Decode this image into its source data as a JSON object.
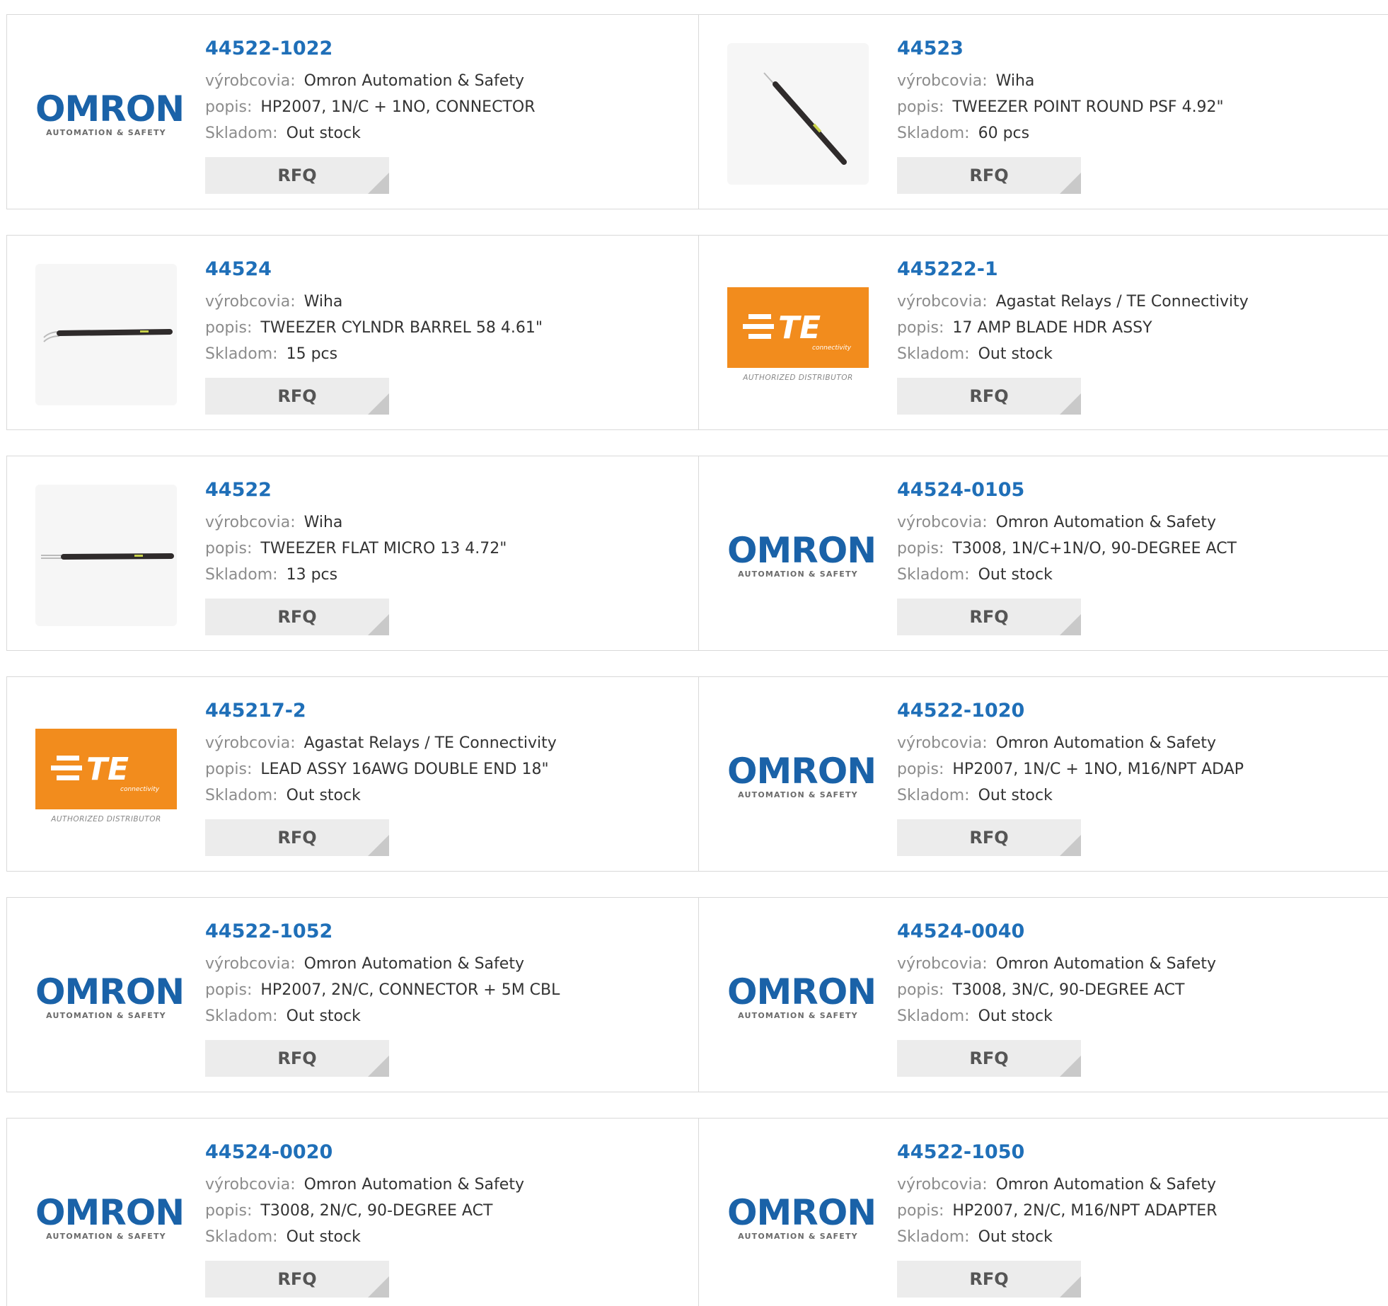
{
  "labels": {
    "manufacturer": "výrobcovia:",
    "description": "popis:",
    "stock": "Skladom:",
    "rfq": "RFQ"
  },
  "logos": {
    "omron_word": "OMRON",
    "omron_sub": "AUTOMATION & SAFETY",
    "te_word": "TE",
    "te_small": "connectivity",
    "te_sub": "AUTHORIZED DISTRIBUTOR"
  },
  "colors": {
    "link": "#1f6fb8",
    "omron_blue": "#1a62a8",
    "te_orange": "#f28c1d",
    "rfq_bg": "#ececec"
  },
  "products": [
    {
      "pn": "44522-1022",
      "mfr": "Omron Automation & Safety",
      "desc": "HP2007, 1N/C + 1NO, CONNECTOR",
      "stock": "Out stock",
      "logo": "omron"
    },
    {
      "pn": "44523",
      "mfr": "Wiha",
      "desc": "TWEEZER POINT ROUND PSF 4.92\"",
      "stock": "60 pcs",
      "logo": "tweezer-diagonal"
    },
    {
      "pn": "44524",
      "mfr": "Wiha",
      "desc": "TWEEZER CYLNDR BARREL 58 4.61\"",
      "stock": "15 pcs",
      "logo": "tweezer-bent"
    },
    {
      "pn": "445222-1",
      "mfr": "Agastat Relays / TE Connectivity",
      "desc": "17 AMP BLADE HDR ASSY",
      "stock": "Out stock",
      "logo": "te"
    },
    {
      "pn": "44522",
      "mfr": "Wiha",
      "desc": "TWEEZER FLAT MICRO 13 4.72\"",
      "stock": "13 pcs",
      "logo": "tweezer-flat"
    },
    {
      "pn": "44524-0105",
      "mfr": "Omron Automation & Safety",
      "desc": "T3008, 1N/C+1N/O, 90-DEGREE ACT",
      "stock": "Out stock",
      "logo": "omron"
    },
    {
      "pn": "445217-2",
      "mfr": "Agastat Relays / TE Connectivity",
      "desc": "LEAD ASSY 16AWG DOUBLE END 18\"",
      "stock": "Out stock",
      "logo": "te"
    },
    {
      "pn": "44522-1020",
      "mfr": "Omron Automation & Safety",
      "desc": "HP2007, 1N/C + 1NO, M16/NPT ADAP",
      "stock": "Out stock",
      "logo": "omron"
    },
    {
      "pn": "44522-1052",
      "mfr": "Omron Automation & Safety",
      "desc": "HP2007, 2N/C, CONNECTOR + 5M CBL",
      "stock": "Out stock",
      "logo": "omron"
    },
    {
      "pn": "44524-0040",
      "mfr": "Omron Automation & Safety",
      "desc": "T3008, 3N/C, 90-DEGREE ACT",
      "stock": "Out stock",
      "logo": "omron"
    },
    {
      "pn": "44524-0020",
      "mfr": "Omron Automation & Safety",
      "desc": "T3008, 2N/C, 90-DEGREE ACT",
      "stock": "Out stock",
      "logo": "omron"
    },
    {
      "pn": "44522-1050",
      "mfr": "Omron Automation & Safety",
      "desc": "HP2007, 2N/C, M16/NPT ADAPTER",
      "stock": "Out stock",
      "logo": "omron"
    }
  ]
}
